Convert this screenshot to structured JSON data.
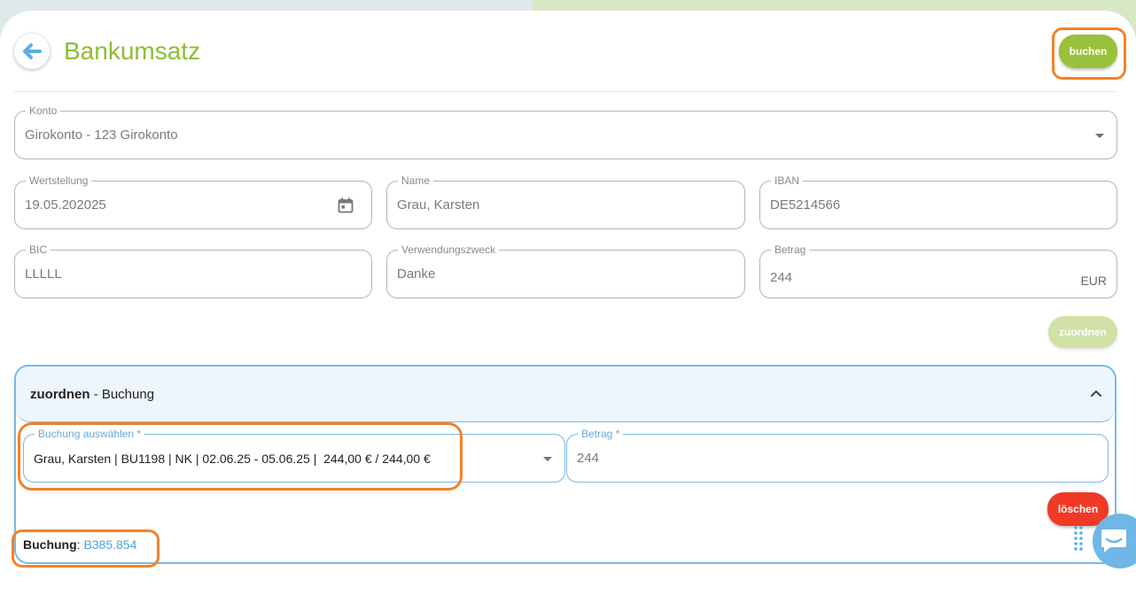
{
  "header": {
    "title": "Bankumsatz",
    "book_button": "buchen"
  },
  "form": {
    "konto": {
      "label": "Konto",
      "value": "Girokonto - 123 Girokonto"
    },
    "wertstellung": {
      "label": "Wertstellung",
      "value": "19.05.202025"
    },
    "name": {
      "label": "Name",
      "value": "Grau, Karsten"
    },
    "iban": {
      "label": "IBAN",
      "value": "DE5214566"
    },
    "bic": {
      "label": "BIC",
      "value": "LLLLL"
    },
    "verwendungszweck": {
      "label": "Verwendungszweck",
      "value": "Danke"
    },
    "betrag": {
      "label": "Betrag",
      "value": "244",
      "currency": "EUR"
    },
    "assign_button": "zuordnen"
  },
  "assignment": {
    "title_bold": "zuordnen",
    "title_rest": " - Buchung",
    "select": {
      "label": "Buchung auswählen *",
      "value": "Grau, Karsten | BU1198 | NK | 02.06.25 - 05.06.25 |  244,00 € / 244,00 €"
    },
    "amount": {
      "label": "Betrag *",
      "value": "244"
    },
    "delete_button": "löschen",
    "booking_label": "Buchung",
    "booking_sep": ": ",
    "booking_id": "B385.854"
  },
  "colors": {
    "accent_green": "#9ac13c",
    "accent_blue": "#7ab8e4",
    "delete_red": "#f03a25",
    "highlight_orange": "#f58025"
  }
}
